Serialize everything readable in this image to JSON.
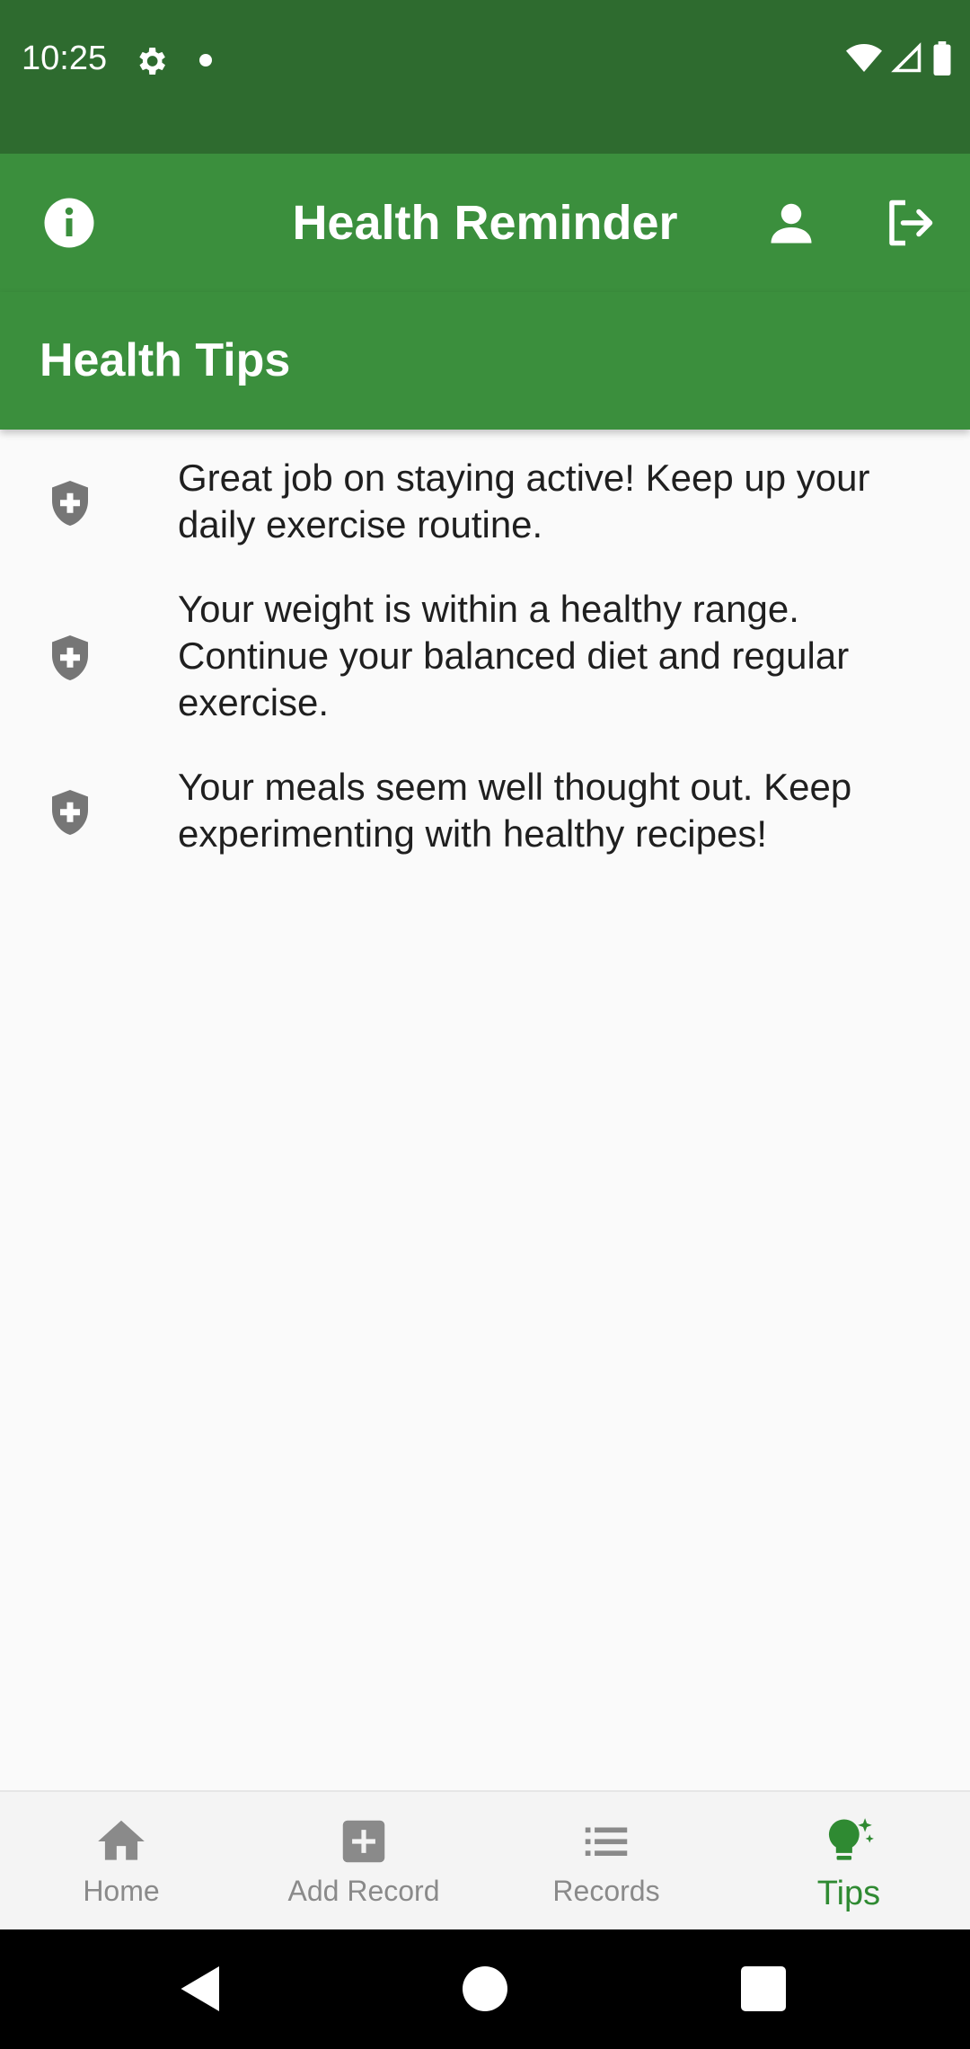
{
  "status_bar": {
    "time": "10:25"
  },
  "app_bar": {
    "title": "Health Reminder"
  },
  "section": {
    "title": "Health Tips"
  },
  "tips": [
    {
      "text": "Great job on staying active! Keep up your daily exercise routine.",
      "icon": "shield-plus-icon"
    },
    {
      "text": "Your weight is within a healthy range. Continue your balanced diet and regular exercise.",
      "icon": "shield-plus-icon"
    },
    {
      "text": "Your meals seem well thought out. Keep experimenting with healthy recipes!",
      "icon": "shield-plus-icon"
    }
  ],
  "bottom_nav": {
    "items": [
      {
        "label": "Home",
        "icon": "home-icon",
        "active": false
      },
      {
        "label": "Add Record",
        "icon": "add-box-icon",
        "active": false
      },
      {
        "label": "Records",
        "icon": "list-icon",
        "active": false
      },
      {
        "label": "Tips",
        "icon": "tips-lightbulb-icon",
        "active": true
      }
    ]
  },
  "colors": {
    "status_bar": "#2e6b2f",
    "app_bar": "#3b8f3d",
    "active_nav": "#2f8a32",
    "inactive_nav": "#8a8a8a",
    "background": "#fafafa"
  }
}
